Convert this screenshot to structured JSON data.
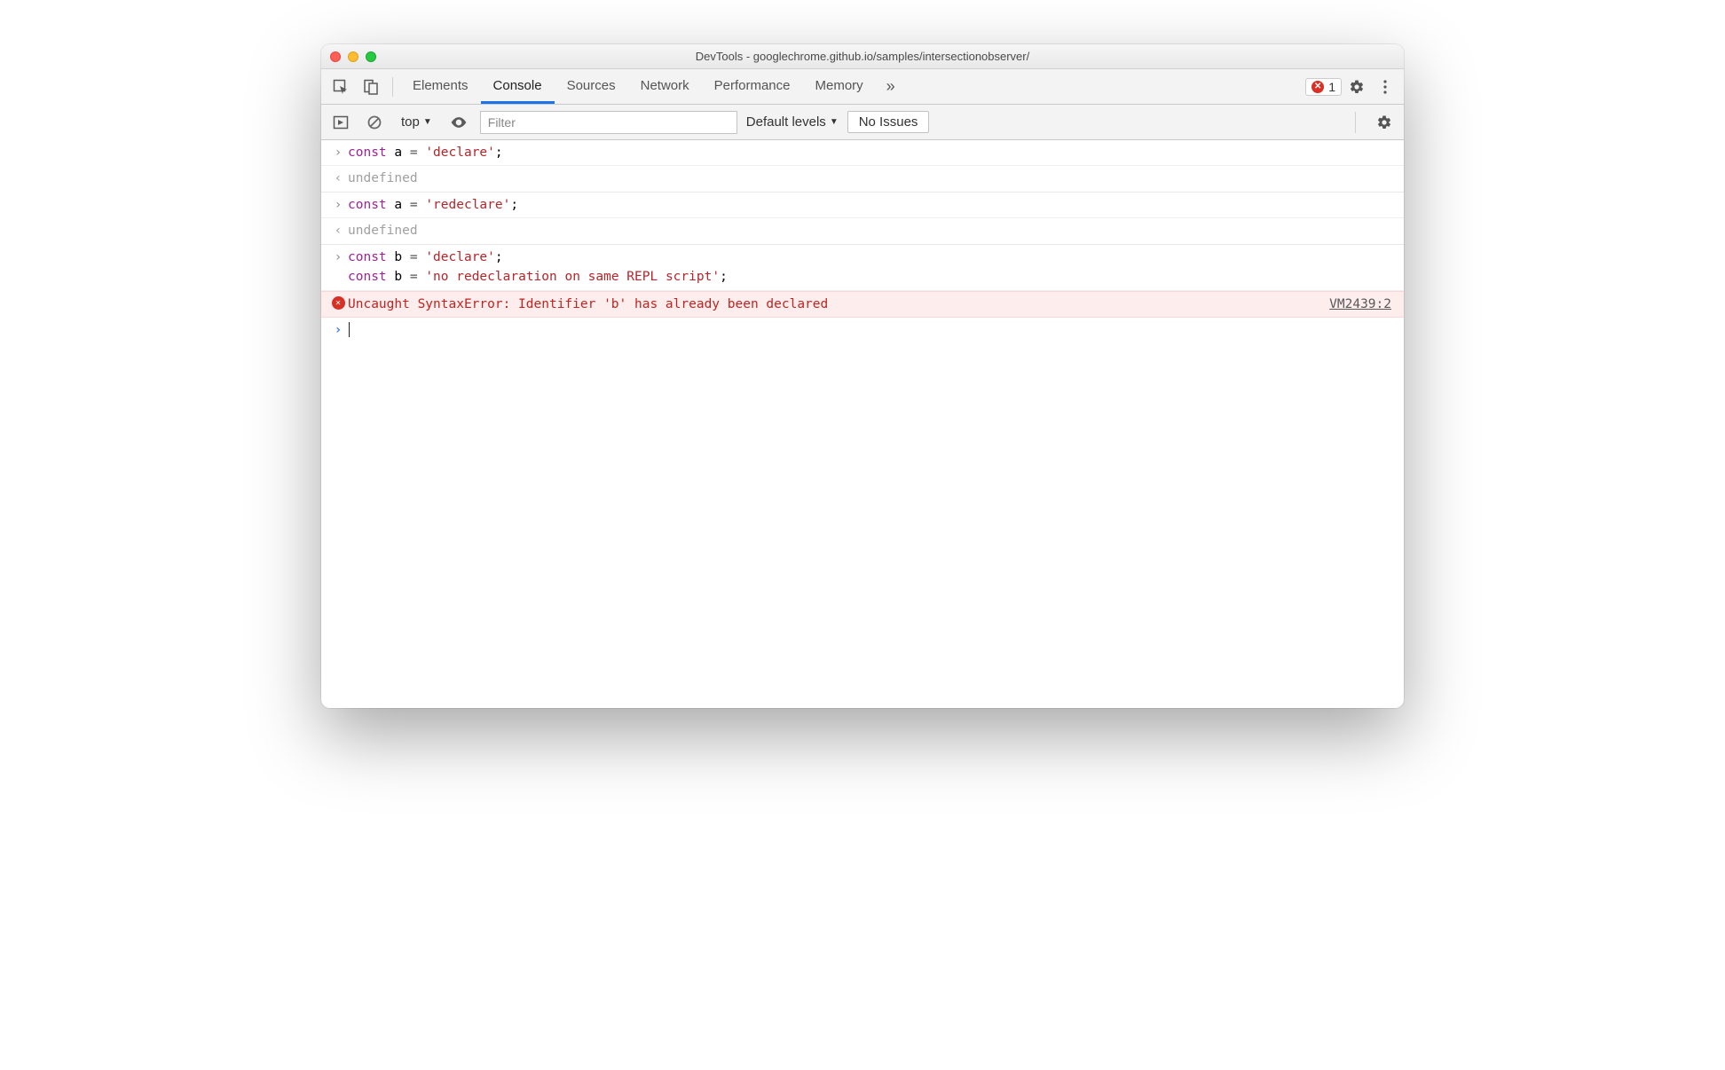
{
  "window": {
    "title": "DevTools - googlechrome.github.io/samples/intersectionobserver/"
  },
  "tabs": {
    "items": [
      "Elements",
      "Console",
      "Sources",
      "Network",
      "Performance",
      "Memory"
    ],
    "active_index": 1,
    "more_glyph": "»"
  },
  "toolbar_right": {
    "error_count": "1"
  },
  "filter": {
    "context": "top",
    "placeholder": "Filter",
    "levels_label": "Default levels",
    "issues_label": "No Issues"
  },
  "console": {
    "entries": [
      {
        "type": "input",
        "tokens": [
          {
            "t": "const",
            "c": "k-keyword"
          },
          {
            "t": " a ",
            "c": ""
          },
          {
            "t": "=",
            "c": "k-eq"
          },
          {
            "t": " ",
            "c": ""
          },
          {
            "t": "'declare'",
            "c": "k-string"
          },
          {
            "t": ";",
            "c": ""
          }
        ]
      },
      {
        "type": "result",
        "text": "undefined"
      },
      {
        "type": "input",
        "tokens": [
          {
            "t": "const",
            "c": "k-keyword"
          },
          {
            "t": " a ",
            "c": ""
          },
          {
            "t": "=",
            "c": "k-eq"
          },
          {
            "t": " ",
            "c": ""
          },
          {
            "t": "'redeclare'",
            "c": "k-string"
          },
          {
            "t": ";",
            "c": ""
          }
        ]
      },
      {
        "type": "result",
        "text": "undefined"
      },
      {
        "type": "input-multi",
        "lines": [
          [
            {
              "t": "const",
              "c": "k-keyword"
            },
            {
              "t": " b ",
              "c": ""
            },
            {
              "t": "=",
              "c": "k-eq"
            },
            {
              "t": " ",
              "c": ""
            },
            {
              "t": "'declare'",
              "c": "k-string"
            },
            {
              "t": ";",
              "c": ""
            }
          ],
          [
            {
              "t": "const",
              "c": "k-keyword"
            },
            {
              "t": " b ",
              "c": ""
            },
            {
              "t": "=",
              "c": "k-eq"
            },
            {
              "t": " ",
              "c": ""
            },
            {
              "t": "'no redeclaration on same REPL script'",
              "c": "k-string"
            },
            {
              "t": ";",
              "c": ""
            }
          ]
        ]
      },
      {
        "type": "error",
        "text": "Uncaught SyntaxError: Identifier 'b' has already been declared",
        "source": "VM2439:2"
      }
    ]
  }
}
